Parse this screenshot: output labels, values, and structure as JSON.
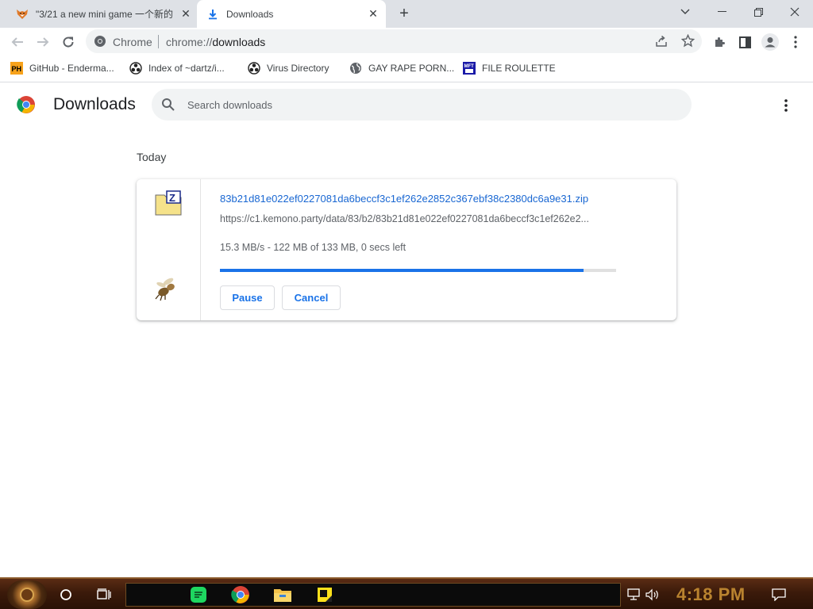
{
  "tabs": [
    {
      "title": "\"3/21 a new mini game 一个新的",
      "icon": "fox-favicon-icon",
      "active": false
    },
    {
      "title": "Downloads",
      "icon": "download-icon",
      "active": true
    }
  ],
  "omnibox": {
    "scheme_label": "Chrome",
    "url_prefix": "chrome://",
    "url_host": "downloads"
  },
  "bookmarks": [
    {
      "label": "GitHub - Enderma...",
      "icon": "ph-logo-icon"
    },
    {
      "label": "Index of ~dartz/i...",
      "icon": "biohazard-icon"
    },
    {
      "label": "Virus Directory",
      "icon": "biohazard-icon"
    },
    {
      "label": "GAY RAPE PORN...",
      "icon": "globe-icon"
    },
    {
      "label": "FILE ROULETTE",
      "icon": "mft-logo-icon"
    }
  ],
  "page": {
    "title": "Downloads",
    "search_placeholder": "Search downloads"
  },
  "downloads": {
    "date_header": "Today",
    "items": [
      {
        "file_name": "83b21d81e022ef0227081da6beccf3c1ef262e2852c367ebf38c2380dc6a9e31.zip",
        "url": "https://c1.kemono.party/data/83/b2/83b21d81e022ef0227081da6beccf3c1ef262e2...",
        "status": "15.3 MB/s - 122 MB of 133 MB, 0 secs left",
        "progress": 0.917,
        "pause_label": "Pause",
        "cancel_label": "Cancel"
      }
    ]
  },
  "taskbar": {
    "clock": "4:18 PM"
  },
  "colors": {
    "accent": "#1a73e8",
    "tabstrip": "#dee1e6",
    "taskbar": "#3b1a0a",
    "clock": "#b9832f"
  }
}
